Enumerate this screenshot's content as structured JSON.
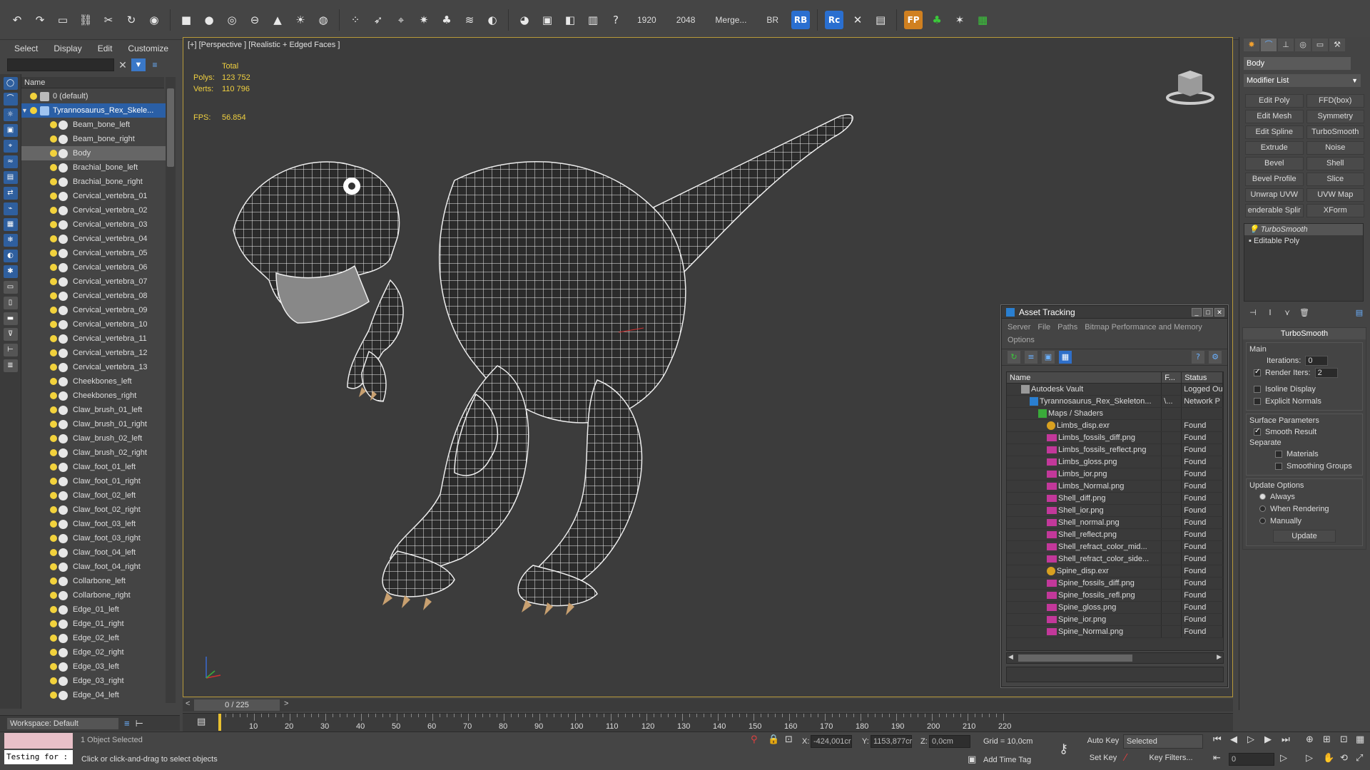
{
  "toolbar": {
    "render_width": "1920",
    "render_height": "2048",
    "merge_label": "Merge...",
    "br_label": "BR",
    "rb_badge": "RB",
    "rc_badge": "Rc",
    "fp_badge": "FP",
    "icons": [
      "select-object",
      "select-region",
      "window-crossing",
      "link",
      "unlink",
      "bind-spacewarp",
      "teapot-render",
      "box",
      "sphere-primitive",
      "geosphere",
      "cylinder",
      "cone",
      "light-sun",
      "omni",
      "particles",
      "forces",
      "helper",
      "bones",
      "nurbs",
      "compound",
      "wind",
      "material-editor",
      "render-setup",
      "render-frame",
      "render",
      "help"
    ]
  },
  "explorer": {
    "menu": [
      "Select",
      "Display",
      "Edit",
      "Customize"
    ],
    "search_placeholder": "",
    "column_name": "Name",
    "layer_default": "0 (default)",
    "layer_main": "Tyrannosaurus_Rex_Skele...",
    "objects": [
      "Beam_bone_left",
      "Beam_bone_right",
      "Body",
      "Brachial_bone_left",
      "Brachial_bone_right",
      "Cervical_vertebra_01",
      "Cervical_vertebra_02",
      "Cervical_vertebra_03",
      "Cervical_vertebra_04",
      "Cervical_vertebra_05",
      "Cervical_vertebra_06",
      "Cervical_vertebra_07",
      "Cervical_vertebra_08",
      "Cervical_vertebra_09",
      "Cervical_vertebra_10",
      "Cervical_vertebra_11",
      "Cervical_vertebra_12",
      "Cervical_vertebra_13",
      "Cheekbones_left",
      "Cheekbones_right",
      "Claw_brush_01_left",
      "Claw_brush_01_right",
      "Claw_brush_02_left",
      "Claw_brush_02_right",
      "Claw_foot_01_left",
      "Claw_foot_01_right",
      "Claw_foot_02_left",
      "Claw_foot_02_right",
      "Claw_foot_03_left",
      "Claw_foot_03_right",
      "Claw_foot_04_left",
      "Claw_foot_04_right",
      "Collarbone_left",
      "Collarbone_right",
      "Edge_01_left",
      "Edge_01_right",
      "Edge_02_left",
      "Edge_02_right",
      "Edge_03_left",
      "Edge_03_right",
      "Edge_04_left"
    ],
    "selected_object": "Body",
    "workspace": "Workspace: Default"
  },
  "viewport": {
    "label": "[+] [Perspective ] [Realistic + Edged Faces ]",
    "stats_total": "Total",
    "polys_label": "Polys:",
    "polys_value": "123 752",
    "verts_label": "Verts:",
    "verts_value": "110 796",
    "fps_label": "FPS:",
    "fps_value": "56.854"
  },
  "asset_tracking": {
    "title": "Asset Tracking",
    "menu": [
      "Server",
      "File",
      "Paths",
      "Bitmap Performance and Memory",
      "Options"
    ],
    "col_name": "Name",
    "col_full": "F...",
    "col_status": "Status",
    "rows": [
      {
        "name": "Autodesk Vault",
        "full": "",
        "status": "Logged Ou",
        "icon": "vault-icon",
        "indent": 1
      },
      {
        "name": "Tyrannosaurus_Rex_Skeleton...",
        "full": "\\...",
        "status": "Network P",
        "icon": "scene-file-icon",
        "indent": 2
      },
      {
        "name": "Maps / Shaders",
        "full": "",
        "status": "",
        "icon": "maps-folder-icon",
        "indent": 3
      },
      {
        "name": "Limbs_disp.exr",
        "full": "",
        "status": "Found",
        "icon": "displacement-icon",
        "indent": 4
      },
      {
        "name": "Limbs_fossils_diff.png",
        "full": "",
        "status": "Found",
        "icon": "png-file-icon",
        "indent": 4
      },
      {
        "name": "Limbs_fossils_reflect.png",
        "full": "",
        "status": "Found",
        "icon": "png-file-icon",
        "indent": 4
      },
      {
        "name": "Limbs_gloss.png",
        "full": "",
        "status": "Found",
        "icon": "png-file-icon",
        "indent": 4
      },
      {
        "name": "Limbs_ior.png",
        "full": "",
        "status": "Found",
        "icon": "png-file-icon",
        "indent": 4
      },
      {
        "name": "Limbs_Normal.png",
        "full": "",
        "status": "Found",
        "icon": "png-file-icon",
        "indent": 4
      },
      {
        "name": "Shell_diff.png",
        "full": "",
        "status": "Found",
        "icon": "png-file-icon",
        "indent": 4
      },
      {
        "name": "Shell_ior.png",
        "full": "",
        "status": "Found",
        "icon": "png-file-icon",
        "indent": 4
      },
      {
        "name": "Shell_normal.png",
        "full": "",
        "status": "Found",
        "icon": "png-file-icon",
        "indent": 4
      },
      {
        "name": "Shell_reflect.png",
        "full": "",
        "status": "Found",
        "icon": "png-file-icon",
        "indent": 4
      },
      {
        "name": "Shell_refract_color_mid...",
        "full": "",
        "status": "Found",
        "icon": "png-file-icon",
        "indent": 4
      },
      {
        "name": "Shell_refract_color_side...",
        "full": "",
        "status": "Found",
        "icon": "png-file-icon",
        "indent": 4
      },
      {
        "name": "Spine_disp.exr",
        "full": "",
        "status": "Found",
        "icon": "displacement-icon",
        "indent": 4
      },
      {
        "name": "Spine_fossils_diff.png",
        "full": "",
        "status": "Found",
        "icon": "png-file-icon",
        "indent": 4
      },
      {
        "name": "Spine_fossils_refl.png",
        "full": "",
        "status": "Found",
        "icon": "png-file-icon",
        "indent": 4
      },
      {
        "name": "Spine_gloss.png",
        "full": "",
        "status": "Found",
        "icon": "png-file-icon",
        "indent": 4
      },
      {
        "name": "Spine_ior.png",
        "full": "",
        "status": "Found",
        "icon": "png-file-icon",
        "indent": 4
      },
      {
        "name": "Spine_Normal.png",
        "full": "",
        "status": "Found",
        "icon": "png-file-icon",
        "indent": 4
      }
    ]
  },
  "command_panel": {
    "object_name": "Body",
    "modifier_list": "Modifier List",
    "buttons": [
      "Edit Poly",
      "FFD(box)",
      "Edit Mesh",
      "Symmetry",
      "Edit Spline",
      "TurboSmooth",
      "Extrude",
      "Noise",
      "Bevel",
      "Shell",
      "Bevel Profile",
      "Slice",
      "Unwrap UVW",
      "UVW Map",
      "enderable Splir",
      "XForm"
    ],
    "stack": [
      "TurboSmooth",
      "Editable Poly"
    ],
    "rollout_title": "TurboSmooth",
    "main_group": "Main",
    "iterations_label": "Iterations:",
    "iterations_value": "0",
    "render_iters_label": "Render Iters:",
    "render_iters_value": "2",
    "isoline_label": "Isoline Display",
    "explicit_normals_label": "Explicit Normals",
    "surface_group": "Surface Parameters",
    "smooth_result_label": "Smooth Result",
    "separate_label": "Separate",
    "materials_label": "Materials",
    "smoothing_groups_label": "Smoothing Groups",
    "update_group": "Update Options",
    "always_label": "Always",
    "when_rendering_label": "When Rendering",
    "manually_label": "Manually",
    "update_button": "Update"
  },
  "timeline": {
    "frame_display": "0 / 225",
    "ticks": [
      "10",
      "20",
      "30",
      "40",
      "50",
      "60",
      "70",
      "80",
      "90",
      "100",
      "110",
      "120",
      "130",
      "140",
      "150",
      "160",
      "170",
      "180",
      "190",
      "200",
      "210",
      "220"
    ]
  },
  "status": {
    "maxscript_text": "Testing for :",
    "selection": "1 Object Selected",
    "prompt": "Click or click-and-drag to select objects",
    "x_label": "X:",
    "x_value": "-424,001cr",
    "y_label": "Y:",
    "y_value": "1153,877cr",
    "z_label": "Z:",
    "z_value": "0,0cm",
    "grid": "Grid = 10,0cm",
    "add_time_tag": "Add Time Tag",
    "auto_key": "Auto Key",
    "set_key": "Set Key",
    "selected_dropdown": "Selected",
    "key_filters": "Key Filters...",
    "frame_field": "0"
  }
}
